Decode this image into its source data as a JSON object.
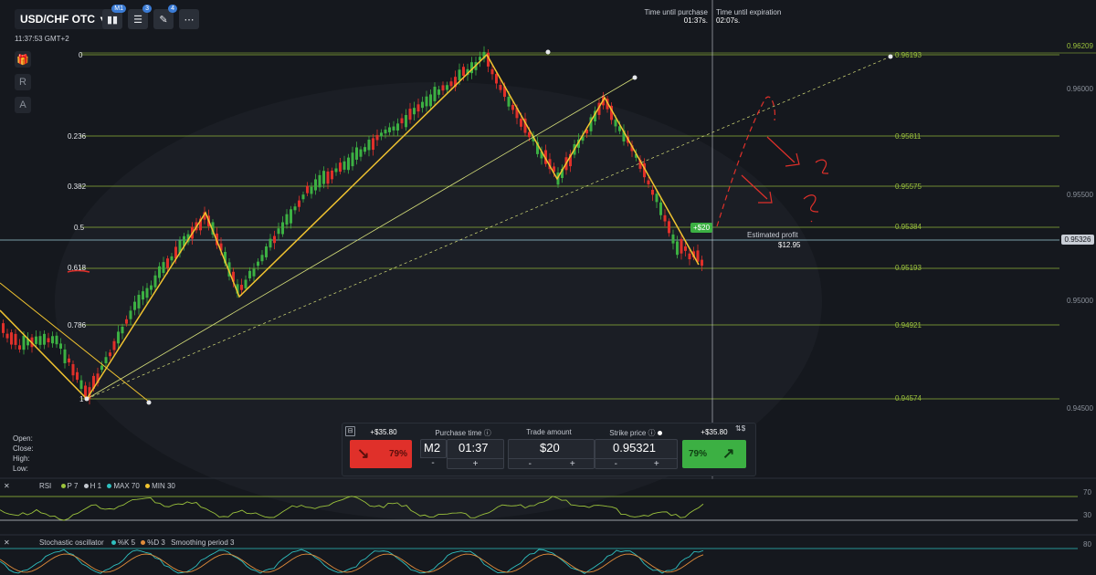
{
  "header": {
    "pair": "USD/CHF OTC",
    "time": "11:37:53 GMT+2",
    "tool_badges": [
      "M1",
      "3",
      "4"
    ]
  },
  "timers": {
    "purchase_label": "Time until purchase",
    "purchase_value": "01:37s.",
    "expiration_label": "Time until expiration",
    "expiration_value": "02:07s."
  },
  "sidebar": [
    "R",
    "A"
  ],
  "fib_levels": [
    {
      "level": "0",
      "price": "0.96193"
    },
    {
      "level": "0.236",
      "price": "0.95811"
    },
    {
      "level": "0.382",
      "price": "0.95575"
    },
    {
      "level": "0.5",
      "price": "0.95384"
    },
    {
      "level": "0.618",
      "price": "0.95193"
    },
    {
      "level": "0.786",
      "price": "0.94921"
    },
    {
      "level": "1",
      "price": "0.94574"
    }
  ],
  "price_axis": {
    "top_label": "0.96209",
    "ticks": [
      "0.96000",
      "0.95500",
      "0.95000",
      "0.94500"
    ],
    "current": "0.95326"
  },
  "trade_marker": "+$20",
  "estimated_profit": {
    "label": "Estimated profit",
    "value": "$12.95"
  },
  "ohlc": [
    "Open:",
    "Close:",
    "High:",
    "Low:"
  ],
  "panel": {
    "sell_payout": "+$35.80",
    "buy_payout": "+$35.80",
    "sell_percent": "79%",
    "buy_percent": "79%",
    "purchase_time_label": "Purchase time",
    "timeframe": "M2",
    "purchase_time": "01:37",
    "trade_amount_label": "Trade amount",
    "trade_amount": "$20",
    "strike_label": "Strike price",
    "strike_price": "0.95321",
    "minus": "-",
    "plus": "+",
    "currency_symbol": "$"
  },
  "rsi": {
    "name": "RSI",
    "params": [
      {
        "label": "P",
        "value": "7",
        "color": "#9bc23c"
      },
      {
        "label": "H",
        "value": "1",
        "color": "#c3c7cf"
      },
      {
        "label": "MAX",
        "value": "70",
        "color": "#2fc0c0"
      },
      {
        "label": "MIN",
        "value": "30",
        "color": "#f0c330"
      }
    ],
    "levels": [
      "70",
      "30"
    ]
  },
  "stoch": {
    "name": "Stochastic oscillator",
    "params": [
      {
        "label": "%K",
        "value": "5",
        "color": "#2fc0c0"
      },
      {
        "label": "%D",
        "value": "3",
        "color": "#e08b3a"
      },
      {
        "label": "Smoothing period",
        "value": "3",
        "color": "#c3c7cf"
      }
    ],
    "level": "80"
  },
  "colors": {
    "up": "#3cb043",
    "down": "#e0302a",
    "fib": "#9bc23c",
    "zigzag": "#f0c330",
    "sell": "#e0302a",
    "buy": "#3cb043"
  }
}
